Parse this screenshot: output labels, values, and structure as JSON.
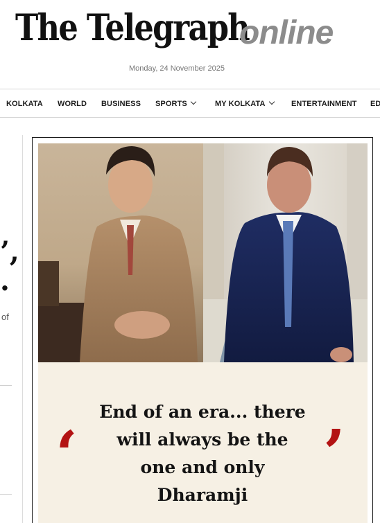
{
  "masthead": {
    "title": "The Telegraph",
    "suffix": "online",
    "date": "Monday, 24 November 2025"
  },
  "nav": {
    "items": [
      {
        "label": "KOLKATA"
      },
      {
        "label": "WORLD"
      },
      {
        "label": "BUSINESS"
      },
      {
        "label": "SPORTS"
      },
      {
        "label": "MY KOLKATA"
      },
      {
        "label": "ENTERTAINMENT"
      },
      {
        "label": "ED"
      }
    ]
  },
  "sidebar": {
    "fragment_1": "’,",
    "fragment_2": ".",
    "fragment_3": "of"
  },
  "article": {
    "quote_line_1": "End of an era... there",
    "quote_line_2": "will always be the",
    "quote_line_3": "one and only",
    "quote_line_4": "Dharamji",
    "quote_open": "‘",
    "quote_close": "’"
  },
  "colors": {
    "accent_red": "#b31313",
    "quote_bg": "#f6f0e4"
  }
}
